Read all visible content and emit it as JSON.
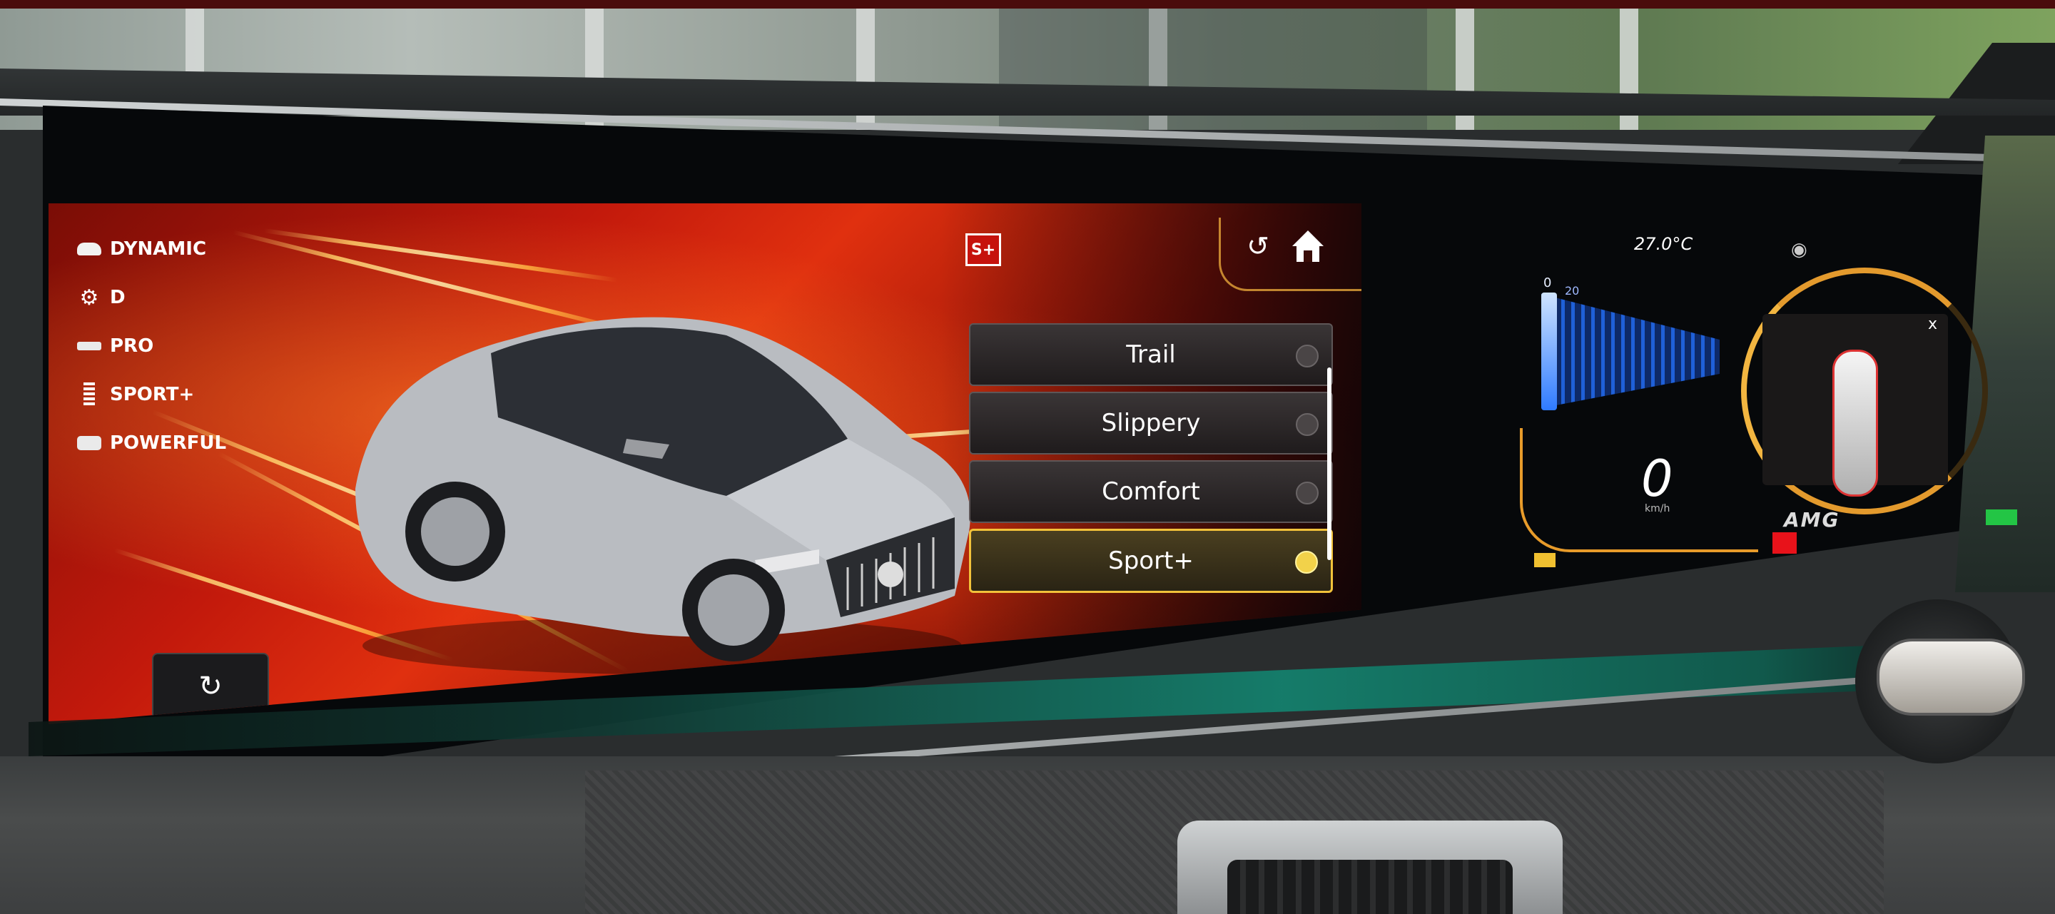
{
  "header": {
    "badge_label": "S+"
  },
  "modes": [
    {
      "icon": "car-icon",
      "label": "DYNAMIC"
    },
    {
      "icon": "transmission-icon",
      "label": "D"
    },
    {
      "icon": "suspension-icon",
      "label": "PRO"
    },
    {
      "icon": "spring-icon",
      "label": "SPORT+"
    },
    {
      "icon": "engine-icon",
      "label": "POWERFUL"
    }
  ],
  "programs": [
    {
      "label": "Trail",
      "selected": false
    },
    {
      "label": "Slippery",
      "selected": false
    },
    {
      "label": "Comfort",
      "selected": false
    },
    {
      "label": "Sport+",
      "selected": true
    }
  ],
  "cluster": {
    "temperature": "27.0°C",
    "speed": "0",
    "speed_unit": "km/h",
    "speed_tick_min": "0",
    "speed_tick_20": "20",
    "brand": "AMG",
    "close_label": "x"
  },
  "colors": {
    "accent": "#f2c23a",
    "background": "#c2190c",
    "speed_bar": "#1f60d8"
  },
  "icons": {
    "back": "back-arrow-icon",
    "home": "home-icon",
    "reset": "reset-icon"
  }
}
